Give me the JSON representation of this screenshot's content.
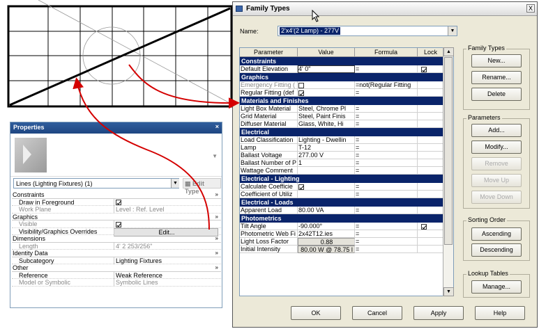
{
  "properties": {
    "title": "Properties",
    "close": "×",
    "selector_value": "Lines (Lighting Fixtures) (1)",
    "edit_type": "Edit Type",
    "rows": [
      {
        "kind": "group",
        "label": "Constraints",
        "collapse": "»"
      },
      {
        "kind": "row",
        "key": "Draw in Foreground",
        "checkbox": true,
        "checked": true
      },
      {
        "kind": "row",
        "key": "Work Plane",
        "value": "Level : Ref. Level",
        "dim": true
      },
      {
        "kind": "group",
        "label": "Graphics",
        "collapse": "»"
      },
      {
        "kind": "row",
        "key": "Visible",
        "checkbox": true,
        "checked": true,
        "dim": true
      },
      {
        "kind": "row",
        "key": "Visibility/Graphics Overrides",
        "value": "Edit...",
        "button": true
      },
      {
        "kind": "group",
        "label": "Dimensions",
        "collapse": "»"
      },
      {
        "kind": "row",
        "key": "Length",
        "value": "4'  2 253/256\"",
        "dim": true
      },
      {
        "kind": "group",
        "label": "Identity Data",
        "collapse": "»"
      },
      {
        "kind": "row",
        "key": "Subcategory",
        "value": "Lighting Fixtures"
      },
      {
        "kind": "group",
        "label": "Other",
        "collapse": "»"
      },
      {
        "kind": "row",
        "key": "Reference",
        "value": "Weak Reference"
      },
      {
        "kind": "row",
        "key": "Model or Symbolic",
        "value": "Symbolic Lines",
        "dim": true
      }
    ]
  },
  "dialog": {
    "title": "Family Types",
    "close": "X",
    "name_label": "Name:",
    "name_value": "2'x4'(2 Lamp) - 277V",
    "headers": [
      "Parameter",
      "Value",
      "Formula",
      "Lock"
    ],
    "sections": [
      {
        "name": "Constraints",
        "rows": [
          {
            "param": "Default Elevation",
            "value": "4'  0\"",
            "value_boxed": true,
            "formula": "=",
            "lock": true
          }
        ]
      },
      {
        "name": "Graphics",
        "rows": [
          {
            "param": "Emergency Fitting (",
            "value_checkbox": true,
            "checked": false,
            "formula": "=not(Regular Fitting",
            "dim": true
          },
          {
            "param": "Regular Fitting (def",
            "value_checkbox": true,
            "checked": true,
            "formula": "="
          }
        ]
      },
      {
        "name": "Materials and Finishes",
        "rows": [
          {
            "param": "Light Box Material",
            "value": "Steel, Chrome Pl",
            "formula": "="
          },
          {
            "param": "Grid Material",
            "value": "Steel, Paint Finis",
            "formula": "="
          },
          {
            "param": "Diffuser Material",
            "value": "Glass, White, Hi",
            "formula": "="
          }
        ]
      },
      {
        "name": "Electrical",
        "rows": [
          {
            "param": "Load Classification",
            "value": "Lighting - Dwellin",
            "formula": "="
          },
          {
            "param": "Lamp",
            "value": "T-12",
            "formula": "="
          },
          {
            "param": "Ballast Voltage",
            "value": "277.00 V",
            "formula": "="
          },
          {
            "param": "Ballast Number of P",
            "value": "1",
            "formula": "="
          },
          {
            "param": "Wattage Comment",
            "value": "",
            "formula": "="
          }
        ]
      },
      {
        "name": "Electrical - Lighting",
        "rows": [
          {
            "param": "Calculate Coefficie",
            "value_checkbox": true,
            "checked": true,
            "formula": "="
          },
          {
            "param": "Coefficient of Utiliz",
            "value": "",
            "formula": "="
          }
        ]
      },
      {
        "name": "Electrical - Loads",
        "rows": [
          {
            "param": "Apparent Load",
            "value": "80.00 VA",
            "formula": "="
          }
        ]
      },
      {
        "name": "Photometrics",
        "rows": [
          {
            "param": "Tilt Angle",
            "value": "-90.000°",
            "formula": "=",
            "lock": true
          },
          {
            "param": "Photometric Web Fi",
            "value": "2x42T12.ies",
            "formula": "="
          },
          {
            "param": "Light Loss Factor",
            "value": "0.88",
            "value_button": true,
            "formula": "="
          },
          {
            "param": "Initial Intensity",
            "value": "80.00 W @ 78.75 l",
            "value_button": true,
            "underline": true,
            "formula": "="
          }
        ]
      }
    ],
    "family_types_group": "Family Types",
    "family_types_buttons": [
      "New...",
      "Rename...",
      "Delete"
    ],
    "parameters_group": "Parameters",
    "parameters_buttons": [
      {
        "label": "Add...",
        "enabled": true
      },
      {
        "label": "Modify...",
        "enabled": true
      },
      {
        "label": "Remove",
        "enabled": false
      },
      {
        "label": "Move Up",
        "enabled": false
      },
      {
        "label": "Move Down",
        "enabled": false
      }
    ],
    "sorting_group": "Sorting Order",
    "sorting_buttons": [
      "Ascending",
      "Descending"
    ],
    "lookup_group": "Lookup Tables",
    "lookup_buttons": [
      "Manage..."
    ],
    "bottom_buttons": [
      "OK",
      "Cancel",
      "Apply",
      "Help"
    ]
  },
  "colors": {
    "annotation_arrow": "#d40000",
    "selection": "#0a246a"
  }
}
